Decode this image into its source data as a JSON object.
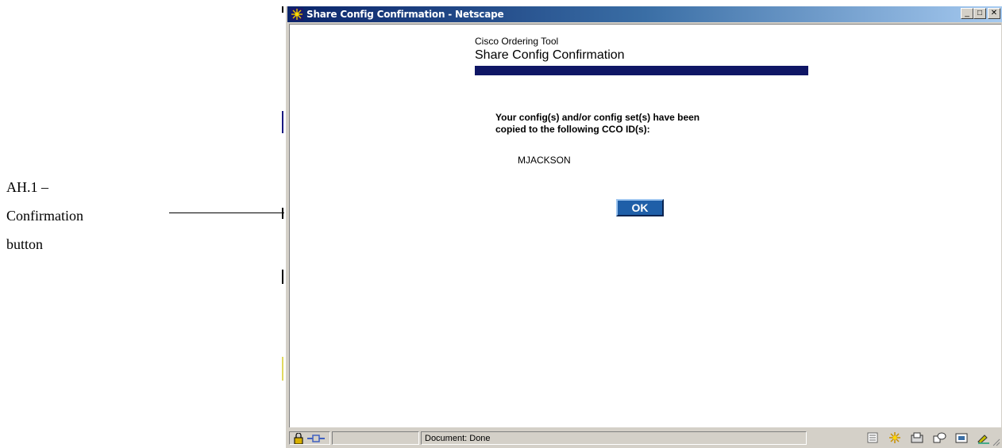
{
  "annotation": {
    "lines": [
      "AH.1 –",
      "Confirmation",
      "button"
    ]
  },
  "window": {
    "title": "Share Config Confirmation - Netscape",
    "controls": {
      "minimize": "_",
      "maximize": "□",
      "close": "✕"
    }
  },
  "page": {
    "app_name": "Cisco Ordering Tool",
    "title": "Share Config Confirmation",
    "message_line1": "Your config(s) and/or config set(s) have been",
    "message_line2": "copied to the following CCO ID(s):",
    "cco_id": "MJACKSON",
    "ok_label": "OK"
  },
  "statusbar": {
    "status_text": "Document: Done"
  },
  "colors": {
    "title_bar_start": "#0a246a",
    "title_bar_end": "#a6caf0",
    "heading_rule": "#0f1665",
    "ok_button": "#1f5fa8"
  }
}
